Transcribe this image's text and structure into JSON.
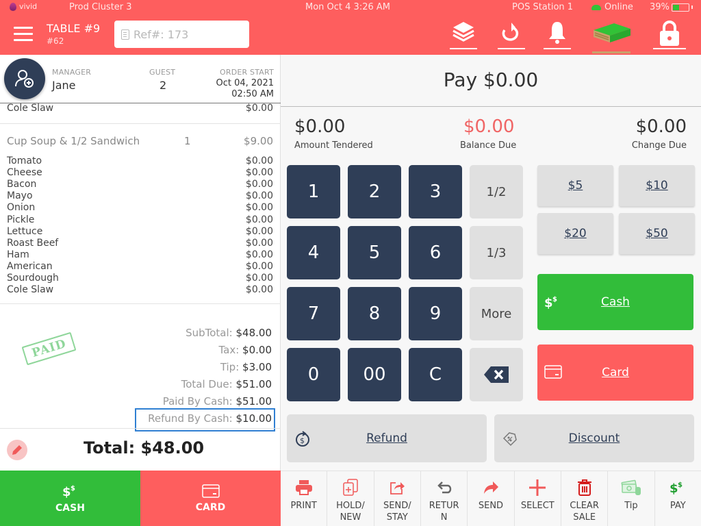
{
  "status_bar": {
    "brand": "vivid",
    "cluster": "Prod Cluster 3",
    "datetime": "Mon Oct 4 3:26 AM",
    "station": "POS Station 1",
    "connection": "Online",
    "battery": "39%",
    "battery_level": 0.39
  },
  "header": {
    "table_title": "TABLE #9",
    "table_sub": "#62",
    "ref_placeholder": "Ref#: 173",
    "icons": [
      "layers-icon",
      "refresh-icon",
      "bell-icon",
      "money-stack-icon",
      "lock-icon"
    ]
  },
  "order": {
    "manager_label": "MANAGER",
    "manager": "Jane",
    "guest_label": "GUEST",
    "guest": "2",
    "start_label": "ORDER START",
    "start_date": "Oct 04, 2021",
    "start_time": "02:50 AM",
    "prev_item": {
      "name": "Cole Slaw",
      "price": "$0.00"
    },
    "main_item": {
      "name": "Cup Soup & 1/2 Sandwich",
      "qty": "1",
      "price": "$9.00"
    },
    "modifiers": [
      {
        "name": "Tomato",
        "price": "$0.00"
      },
      {
        "name": "Cheese",
        "price": "$0.00"
      },
      {
        "name": "Bacon",
        "price": "$0.00"
      },
      {
        "name": "Mayo",
        "price": "$0.00"
      },
      {
        "name": "Onion",
        "price": "$0.00"
      },
      {
        "name": "Pickle",
        "price": "$0.00"
      },
      {
        "name": "Lettuce",
        "price": "$0.00"
      },
      {
        "name": "Roast Beef",
        "price": "$0.00"
      },
      {
        "name": "Ham",
        "price": "$0.00"
      },
      {
        "name": "American",
        "price": "$0.00"
      },
      {
        "name": "Sourdough",
        "price": "$0.00"
      },
      {
        "name": "Cole Slaw",
        "price": "$0.00"
      }
    ],
    "paid_stamp": "PAID",
    "totals": [
      {
        "label": "SubTotal:",
        "value": "$48.00"
      },
      {
        "label": "Tax:",
        "value": "$0.00"
      },
      {
        "label": "Tip:",
        "value": "$3.00"
      },
      {
        "label": "Total Due:",
        "value": "$51.00"
      },
      {
        "label": "Paid By Cash:",
        "value": "$51.00"
      },
      {
        "label": "Refund By Cash:",
        "value": "$10.00"
      }
    ],
    "grand_total": "Total: $48.00"
  },
  "left_buttons": {
    "cash": "CASH",
    "card": "CARD"
  },
  "payment": {
    "title": "Pay $0.00",
    "amount_tendered": "$0.00",
    "amount_tendered_label": "Amount Tendered",
    "balance_due": "$0.00",
    "balance_due_label": "Balance Due",
    "change_due": "$0.00",
    "change_due_label": "Change Due",
    "keypad": [
      "1",
      "2",
      "3",
      "4",
      "5",
      "6",
      "7",
      "8",
      "9",
      "0",
      "00",
      "C"
    ],
    "side_keys": [
      "1/2",
      "1/3",
      "More"
    ],
    "quick_amounts": [
      "$5",
      "$10",
      "$20",
      "$50"
    ],
    "cash_label": "Cash",
    "card_label": "Card",
    "refund_label": "Refund",
    "discount_label": "Discount"
  },
  "toolbar": [
    {
      "label": "PRINT",
      "icon": "printer-icon"
    },
    {
      "label": "HOLD/ NEW",
      "icon": "hold-new-icon"
    },
    {
      "label": "SEND/ STAY",
      "icon": "send-stay-icon"
    },
    {
      "label": "RETUR N",
      "icon": "return-icon"
    },
    {
      "label": "SEND",
      "icon": "send-icon"
    },
    {
      "label": "SELECT",
      "icon": "plus-icon"
    },
    {
      "label": "CLEAR SALE",
      "icon": "trash-icon"
    },
    {
      "label": "Tip",
      "icon": "tip-money-icon"
    },
    {
      "label": "PAY",
      "icon": "dollar-icon"
    }
  ],
  "colors": {
    "brand_red": "#fe5e5e",
    "cash_green": "#32bd3a",
    "key_navy": "#2f3e57",
    "balance_red": "#f06565",
    "highlight_blue": "#2f7fd2"
  }
}
